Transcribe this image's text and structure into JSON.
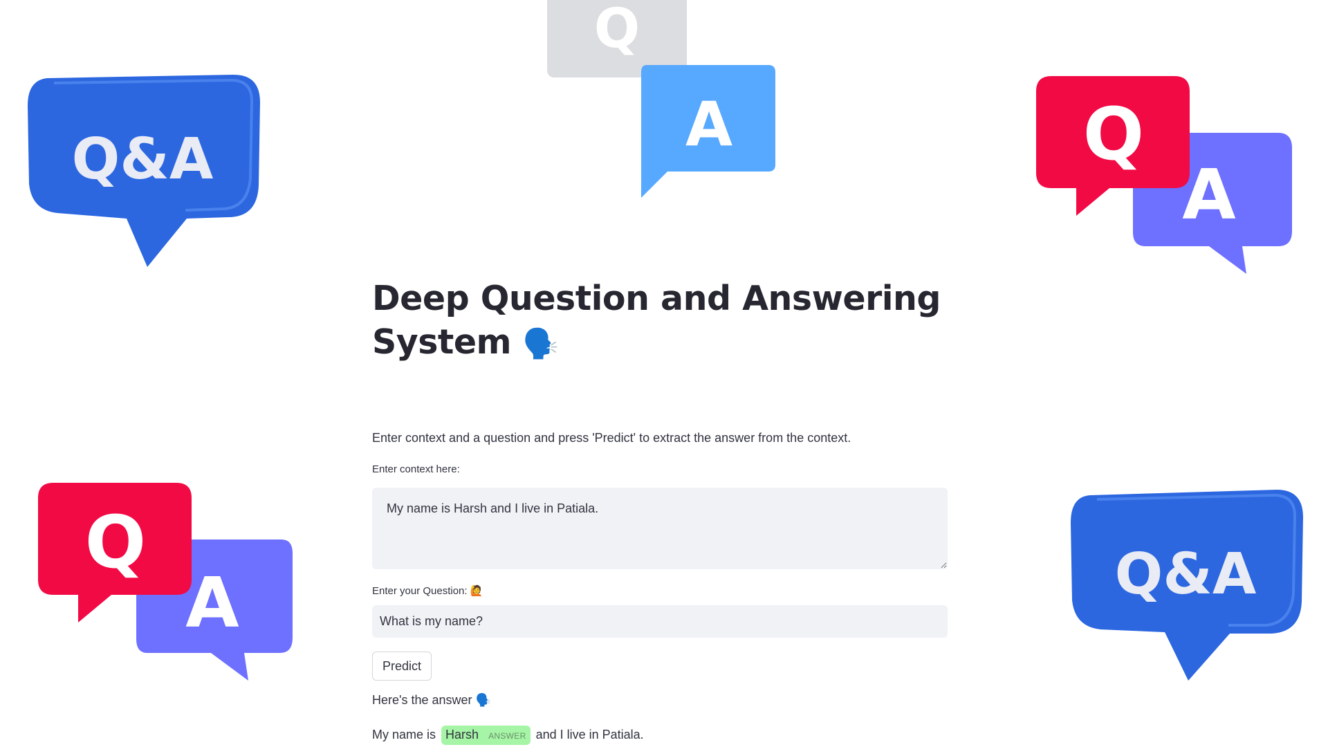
{
  "app": {
    "title": "Deep Question and Answering System",
    "title_emoji": "🗣️",
    "description": "Enter context and a question and press 'Predict' to extract the answer from the context."
  },
  "context": {
    "label": "Enter context here:",
    "value": "My name is Harsh and I live in Patiala."
  },
  "question": {
    "label": "Enter your Question: 🙋",
    "value": "What is my name?"
  },
  "predict_button": {
    "label": "Predict"
  },
  "answer": {
    "heading": "Here's the answer 🗣️",
    "prefix": "My name is",
    "highlight_text": "Harsh",
    "highlight_label": "ANSWER",
    "suffix": "and I live in Patiala."
  },
  "decorations": {
    "bubble_qa_text": "Q&A",
    "bubble_q_text": "Q",
    "bubble_a_text": "A"
  },
  "colors": {
    "blue_bubble": "#2f6fe6",
    "light_blue_bubble": "#57a8ff",
    "grey_bubble": "#dcdde0",
    "red_bubble": "#f20a45",
    "purple_bubble": "#6e70ff",
    "answer_highlight": "#a6f5a6"
  }
}
